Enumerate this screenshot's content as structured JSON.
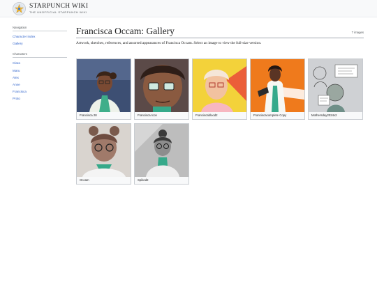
{
  "site": {
    "title": "STARPUNCH WIKI",
    "subtitle": "THE UNOFFICIAL STARPUNCH WIKI",
    "logo_icon": "star-logo-icon"
  },
  "sidebar": {
    "navigation_heading": "Navigation",
    "navigation_items": [
      "Character index",
      "Gallery"
    ],
    "characters_heading": "Characters",
    "character_items": [
      "Clara",
      "Maru",
      "Alex",
      "Anne",
      "Francisca",
      "Proto"
    ]
  },
  "page": {
    "title": "Francisca Occam: Gallery",
    "image_count": "7 images",
    "intro": "Artwork, sketches, references, and assorted appearances of Francisca Occam. Select an image to view the full-size version."
  },
  "gallery": [
    {
      "caption": "Francisca 28",
      "bg": "#3d4f73"
    },
    {
      "caption": "Francisca Icon",
      "bg": "#6a4d45"
    },
    {
      "caption": "Franciscablood2",
      "bg": "#f3d23a"
    },
    {
      "caption": "Franciscacomplete Copy",
      "bg": "#ef7a1c"
    },
    {
      "caption": "Mothersday2024v2",
      "bg": "#cfd1d4"
    },
    {
      "caption": "Occam",
      "bg": "#d9d4cf"
    },
    {
      "caption": "Spiked2",
      "bg": "#bdbdbd"
    }
  ],
  "colors": {
    "link": "#3366cc",
    "accent_teal": "#36a98a"
  }
}
